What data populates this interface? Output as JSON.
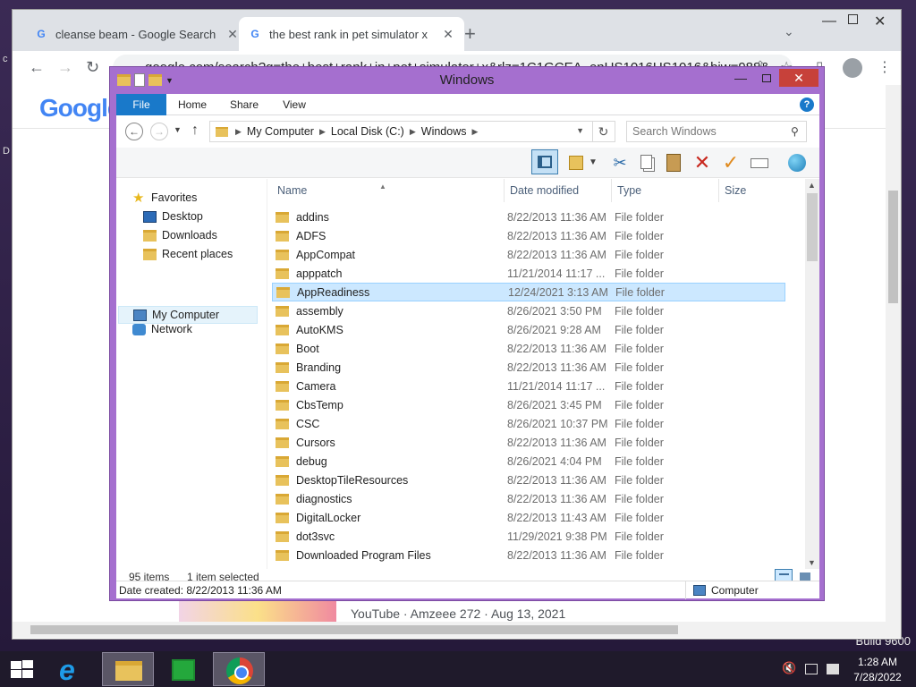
{
  "desktop": {
    "build_text": "Build 9600",
    "left_edge_a": "c",
    "left_edge_b": "D"
  },
  "chrome": {
    "tabs": [
      {
        "title": "cleanse beam - Google Search",
        "active": false
      },
      {
        "title": "the best rank in pet simulator x",
        "active": true
      }
    ],
    "favicon_letter": "G",
    "new_tab_glyph": "+",
    "address_url": "google.com/search?q=the+best+rank+in+pet+simulator+x&rlz=1C1GCEA_enUS1016US1016&biw=988&",
    "logo_text": "Google",
    "youtube_result": "YouTube · Amzeee 272 · Aug 13, 2021",
    "colors": {
      "tabbar": "#dee1e6",
      "omnibox": "#f1f3f4"
    }
  },
  "explorer": {
    "title": "Windows",
    "ribbon_tabs": [
      "File",
      "Home",
      "Share",
      "View"
    ],
    "help_glyph": "?",
    "breadcrumbs": [
      "My Computer",
      "Local Disk (C:)",
      "Windows"
    ],
    "search_placeholder": "Search Windows",
    "columns": {
      "name": "Name",
      "date": "Date modified",
      "type": "Type",
      "size": "Size"
    },
    "nav": {
      "favorites": "Favorites",
      "desktop": "Desktop",
      "downloads": "Downloads",
      "recent": "Recent places",
      "my_computer": "My Computer",
      "network": "Network"
    },
    "files": [
      {
        "name": "addins",
        "date": "8/22/2013 11:36 AM",
        "type": "File folder"
      },
      {
        "name": "ADFS",
        "date": "8/22/2013 11:36 AM",
        "type": "File folder"
      },
      {
        "name": "AppCompat",
        "date": "8/22/2013 11:36 AM",
        "type": "File folder"
      },
      {
        "name": "apppatch",
        "date": "11/21/2014 11:17 ...",
        "type": "File folder"
      },
      {
        "name": "AppReadiness",
        "date": "12/24/2021 3:13 AM",
        "type": "File folder",
        "selected": true
      },
      {
        "name": "assembly",
        "date": "8/26/2021 3:50 PM",
        "type": "File folder"
      },
      {
        "name": "AutoKMS",
        "date": "8/26/2021 9:28 AM",
        "type": "File folder"
      },
      {
        "name": "Boot",
        "date": "8/22/2013 11:36 AM",
        "type": "File folder"
      },
      {
        "name": "Branding",
        "date": "8/22/2013 11:36 AM",
        "type": "File folder"
      },
      {
        "name": "Camera",
        "date": "11/21/2014 11:17 ...",
        "type": "File folder"
      },
      {
        "name": "CbsTemp",
        "date": "8/26/2021 3:45 PM",
        "type": "File folder"
      },
      {
        "name": "CSC",
        "date": "8/26/2021 10:37 PM",
        "type": "File folder"
      },
      {
        "name": "Cursors",
        "date": "8/22/2013 11:36 AM",
        "type": "File folder"
      },
      {
        "name": "debug",
        "date": "8/26/2021 4:04 PM",
        "type": "File folder"
      },
      {
        "name": "DesktopTileResources",
        "date": "8/22/2013 11:36 AM",
        "type": "File folder"
      },
      {
        "name": "diagnostics",
        "date": "8/22/2013 11:36 AM",
        "type": "File folder"
      },
      {
        "name": "DigitalLocker",
        "date": "8/22/2013 11:43 AM",
        "type": "File folder"
      },
      {
        "name": "dot3svc",
        "date": "11/29/2021 9:38 PM",
        "type": "File folder"
      },
      {
        "name": "Downloaded Program Files",
        "date": "8/22/2013 11:36 AM",
        "type": "File folder"
      }
    ],
    "status": {
      "count": "95 items",
      "selected": "1 item selected"
    },
    "details": {
      "date_created": "Date created: 8/22/2013 11:36 AM",
      "location": "Computer"
    },
    "colors": {
      "frame": "#a56fcf",
      "file_tab": "#1979ca",
      "selection": "#cce8ff",
      "close": "#c7413a"
    }
  },
  "taskbar": {
    "time": "1:28 AM",
    "date": "7/28/2022",
    "volume_glyph": "🔇"
  }
}
